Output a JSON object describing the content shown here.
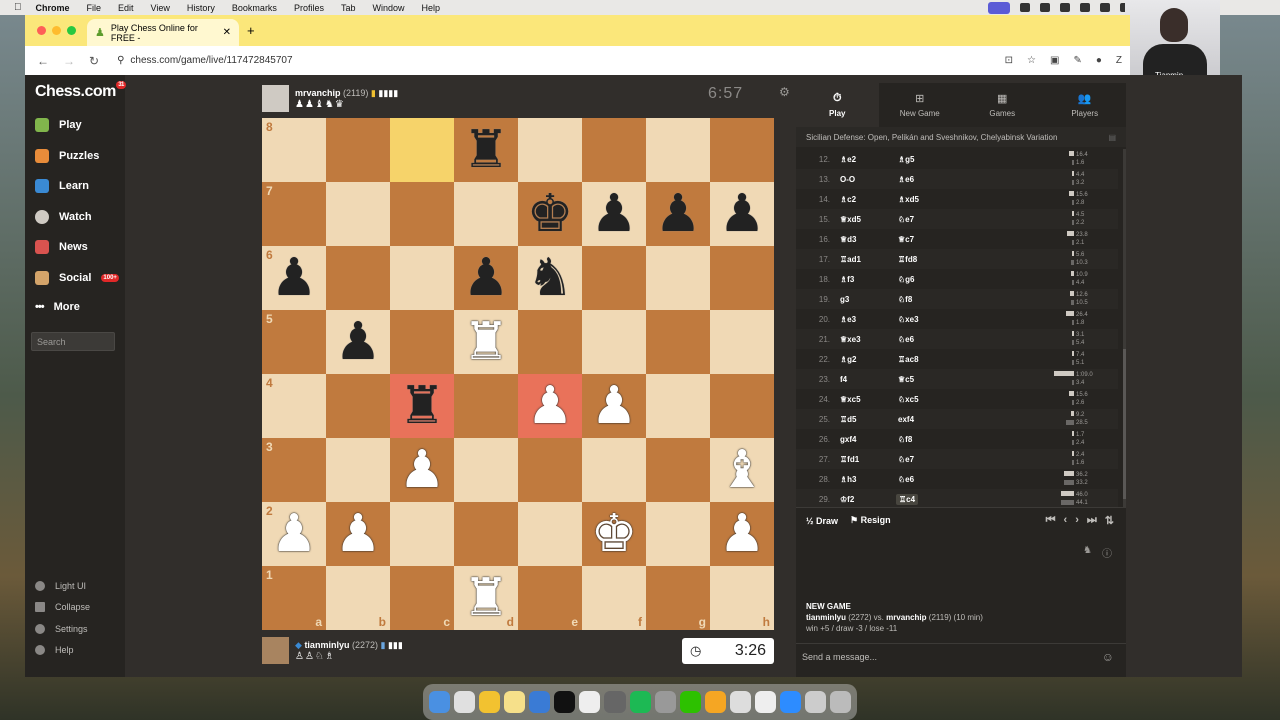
{
  "menubar": {
    "items": [
      "Chrome",
      "File",
      "Edit",
      "View",
      "History",
      "Bookmarks",
      "Profiles",
      "Tab",
      "Window",
      "Help"
    ]
  },
  "webcam": {
    "name": "Tianmin"
  },
  "browser": {
    "tab_title": "Play Chess Online for FREE -",
    "url": "chess.com/game/live/117472845707"
  },
  "sidebar": {
    "logo": "Chess.com",
    "logo_badge": "31",
    "items": [
      {
        "label": "Play",
        "icon": "pawn-icon"
      },
      {
        "label": "Puzzles",
        "icon": "puzzle-icon"
      },
      {
        "label": "Learn",
        "icon": "learn-icon"
      },
      {
        "label": "Watch",
        "icon": "binoculars-icon"
      },
      {
        "label": "News",
        "icon": "news-icon"
      },
      {
        "label": "Social",
        "icon": "social-icon",
        "badge": "100+"
      },
      {
        "label": "More",
        "icon": "more-icon"
      }
    ],
    "search_placeholder": "Search",
    "bottom": [
      "Light UI",
      "Collapse",
      "Settings",
      "Help"
    ]
  },
  "top_player": {
    "name": "mrvanchip",
    "rating": "(2119)",
    "material": "♟♟♝♞♛",
    "clock": "6:57"
  },
  "bottom_player": {
    "name": "tianminlyu",
    "rating": "(2272)",
    "material": "♙♙♘♗",
    "clock": "3:26"
  },
  "board": {
    "ranks": [
      "8",
      "7",
      "6",
      "5",
      "4",
      "3",
      "2",
      "1"
    ],
    "files": [
      "a",
      "b",
      "c",
      "d",
      "e",
      "f",
      "g",
      "h"
    ],
    "position": [
      [
        "",
        "",
        "",
        "r",
        "",
        "",
        "",
        ""
      ],
      [
        "",
        "",
        "",
        "",
        "k",
        "p",
        "p",
        "p"
      ],
      [
        "p",
        "",
        "",
        "p",
        "n",
        "",
        "",
        ""
      ],
      [
        "",
        "p",
        "",
        "R",
        "",
        "",
        "",
        ""
      ],
      [
        "",
        "",
        "r",
        "",
        "P",
        "P",
        "",
        ""
      ],
      [
        "",
        "",
        "P",
        "",
        "",
        "",
        "",
        "B"
      ],
      [
        "P",
        "P",
        "",
        "",
        "",
        "K",
        "",
        "P"
      ],
      [
        "",
        "",
        "",
        "R",
        "",
        "",
        "",
        ""
      ]
    ],
    "highlight_yellow": [
      "c8"
    ],
    "highlight_red": [
      "c4",
      "e4"
    ]
  },
  "panel": {
    "tabs": [
      {
        "label": "Play",
        "icon": "stopwatch-icon"
      },
      {
        "label": "New Game",
        "icon": "plus-icon"
      },
      {
        "label": "Games",
        "icon": "board-icon"
      },
      {
        "label": "Players",
        "icon": "players-icon"
      }
    ],
    "opening": "Sicilian Defense: Open, Pelikán and Sveshnikov, Chelyabinsk Variation",
    "moves": [
      {
        "no": "12.",
        "w": "♗e2",
        "b": "♗g5",
        "t1": "16.4",
        "t2": "1.6"
      },
      {
        "no": "13.",
        "w": "O-O",
        "b": "♗e6",
        "t1": "4.4",
        "t2": "3.2"
      },
      {
        "no": "14.",
        "w": "♗c2",
        "b": "♗xd5",
        "t1": "15.6",
        "t2": "2.8"
      },
      {
        "no": "15.",
        "w": "♕xd5",
        "b": "♘e7",
        "t1": "4.5",
        "t2": "2.2"
      },
      {
        "no": "16.",
        "w": "♕d3",
        "b": "♕c7",
        "t1": "23.8",
        "t2": "2.1"
      },
      {
        "no": "17.",
        "w": "♖ad1",
        "b": "♖fd8",
        "t1": "5.6",
        "t2": "10.3"
      },
      {
        "no": "18.",
        "w": "♗f3",
        "b": "♘g6",
        "t1": "10.9",
        "t2": "4.4"
      },
      {
        "no": "19.",
        "w": "g3",
        "b": "♘f8",
        "t1": "12.6",
        "t2": "10.5"
      },
      {
        "no": "20.",
        "w": "♗e3",
        "b": "♘xe3",
        "t1": "26.4",
        "t2": "1.8"
      },
      {
        "no": "21.",
        "w": "♕xe3",
        "b": "♘e6",
        "t1": "3.1",
        "t2": "5.4"
      },
      {
        "no": "22.",
        "w": "♗g2",
        "b": "♖ac8",
        "t1": "7.4",
        "t2": "5.1"
      },
      {
        "no": "23.",
        "w": "f4",
        "b": "♕c5",
        "t1": "1:09.0",
        "t2": "3.4"
      },
      {
        "no": "24.",
        "w": "♕xc5",
        "b": "♘xc5",
        "t1": "15.6",
        "t2": "2.6"
      },
      {
        "no": "25.",
        "w": "♖d5",
        "b": "exf4",
        "t1": "9.2",
        "t2": "28.5"
      },
      {
        "no": "26.",
        "w": "gxf4",
        "b": "♘f8",
        "t1": "1.7",
        "t2": "2.4"
      },
      {
        "no": "27.",
        "w": "♖fd1",
        "b": "♘e7",
        "t1": "2.4",
        "t2": "1.6"
      },
      {
        "no": "28.",
        "w": "♗h3",
        "b": "♘e6",
        "t1": "36.2",
        "t2": "33.2"
      },
      {
        "no": "29.",
        "w": "♔f2",
        "b": "♖c4",
        "t1": "46.0",
        "t2": "44.1"
      }
    ],
    "draw_label": "Draw",
    "draw_prefix": "½",
    "resign_label": "Resign",
    "new_game": {
      "heading": "NEW GAME",
      "p1": "tianminlyu",
      "p1r": "(2272)",
      "vs": "vs.",
      "p2": "mrvanchip",
      "p2r": "(2119)",
      "mode": "(10 min)",
      "stats": "win +5 / draw -3 / lose -11"
    },
    "message_placeholder": "Send a message..."
  }
}
